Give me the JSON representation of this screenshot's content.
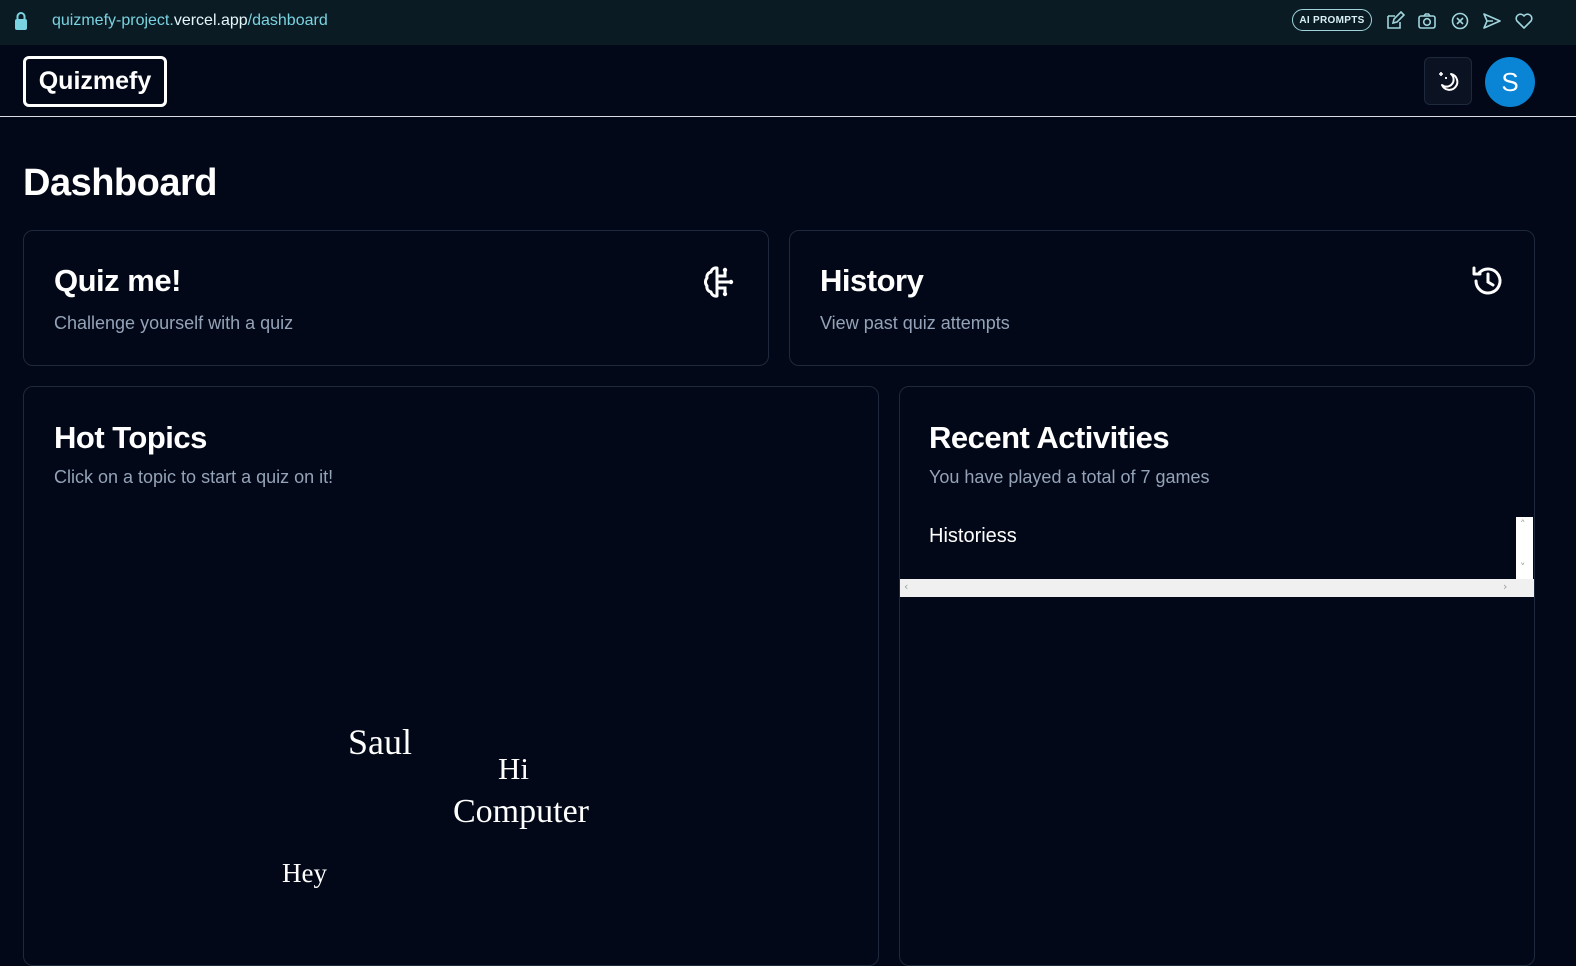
{
  "browser": {
    "url_path_prefix": "quizmefy-project.",
    "url_host": "vercel.app",
    "url_path": "/dashboard",
    "ai_prompts_label": "AI PROMPTS",
    "extension_icons": [
      "edit-icon",
      "camera-icon",
      "close-circle-icon",
      "send-icon",
      "heart-icon"
    ]
  },
  "header": {
    "logo": "Quizmefy",
    "theme_icon": "moon-stars-icon",
    "avatar_initial": "S"
  },
  "page": {
    "title": "Dashboard"
  },
  "quiz_card": {
    "title": "Quiz me!",
    "subtitle": "Challenge yourself with a quiz",
    "icon": "brain-circuit-icon"
  },
  "history_card": {
    "title": "History",
    "subtitle": "View past quiz attempts",
    "icon": "history-icon"
  },
  "hot_topics": {
    "title": "Hot Topics",
    "subtitle": "Click on a topic to start a quiz on it!",
    "words": [
      "Saul",
      "Hi",
      "Computer",
      "Hey"
    ]
  },
  "recent_activities": {
    "title": "Recent Activities",
    "subtitle": "You have played a total of 7 games",
    "items": [
      "Historiess"
    ]
  },
  "colors": {
    "background": "#020817",
    "card_border": "#1e293b",
    "muted_text": "#94a3b8",
    "avatar": "#0a84d4"
  }
}
